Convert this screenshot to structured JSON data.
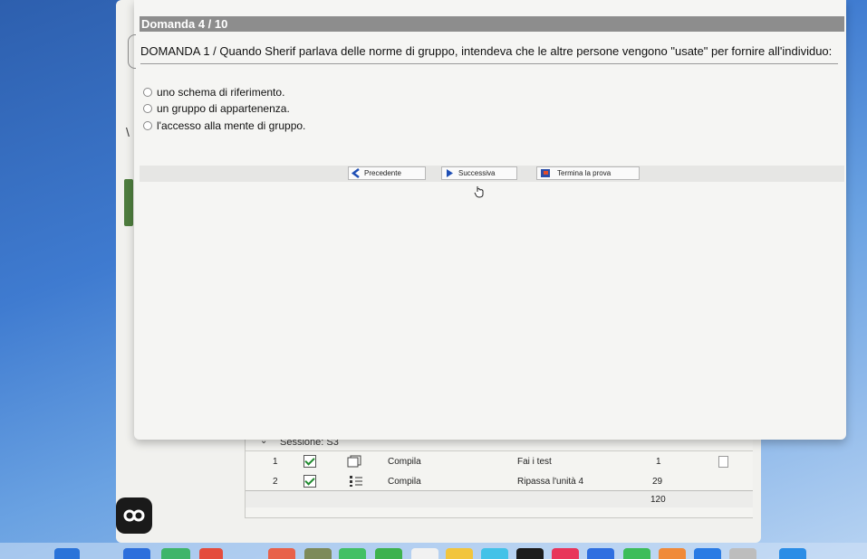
{
  "quiz": {
    "title": "Domanda 4 / 10",
    "question": "DOMANDA 1 / Quando Sherif parlava delle norme di gruppo, intendeva che le altre persone vengono \"usate\" per fornire all'individuo:",
    "options": [
      "uno schema di riferimento.",
      "un gruppo di appartenenza.",
      "l'accesso alla mente di gruppo."
    ],
    "nav": {
      "prev_label": "Precedente",
      "next_label": "Successiva",
      "finish_label": "Termina la prova"
    }
  },
  "session": {
    "header": "Sessione: S3",
    "rows": [
      {
        "num": "1",
        "action": "Compila",
        "activity": "Fai i test",
        "count": "1"
      },
      {
        "num": "2",
        "action": "Compila",
        "activity": "Ripassa l'unità 4",
        "count": "29"
      }
    ],
    "total": "120"
  },
  "icons": {
    "prev": "chevron-left-icon",
    "next": "play-arrow-icon",
    "finish": "flag-icon",
    "cursor": "hand-pointer-icon",
    "doc": "document-icon",
    "list": "list-icon"
  },
  "colors": {
    "titlebar": "#8d8d8d",
    "accent_blue": "#1f4fb5",
    "check_green": "#1f8a2e"
  }
}
